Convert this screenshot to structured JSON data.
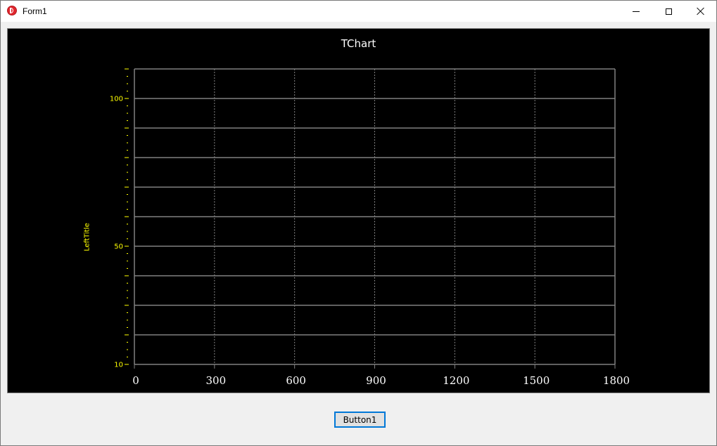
{
  "window": {
    "title": "Form1",
    "icon": "delphi-app-icon"
  },
  "button1": {
    "label": "Button1"
  },
  "chart_data": {
    "type": "line",
    "title": "TChart",
    "xlabel": "",
    "ylabel": "LeftTitle",
    "x_ticks": [
      0,
      300,
      600,
      900,
      1200,
      1500,
      1800
    ],
    "y_tick_labels": [
      10,
      50,
      100
    ],
    "xlim": [
      0,
      1800
    ],
    "ylim": [
      10,
      110
    ],
    "grid": true,
    "series": [],
    "colors": {
      "background": "#000000",
      "grid": "#808080",
      "axis_labels": "#ffff00",
      "bottom_labels": "#ffffff",
      "title": "#ffffff"
    }
  }
}
